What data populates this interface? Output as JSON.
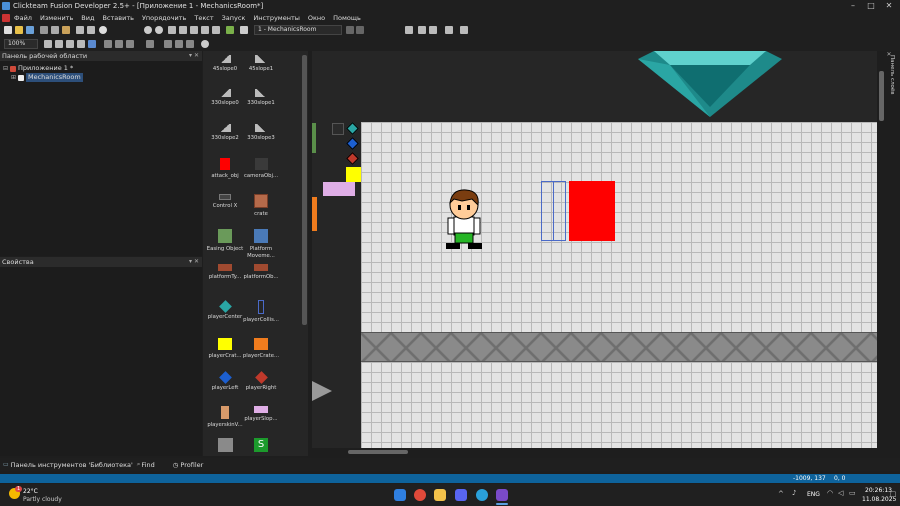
{
  "window": {
    "title": "Clickteam Fusion Developer 2.5+ - [Приложение 1 - MechanicsRoom*]",
    "controls": [
      "–",
      "□",
      "✕"
    ]
  },
  "menu": [
    "Файл",
    "Изменить",
    "Вид",
    "Вставить",
    "Упорядочить",
    "Текст",
    "Запуск",
    "Инструменты",
    "Окно",
    "Помощь"
  ],
  "toolbar": {
    "zoom": "100%",
    "frame_selector": "1 - MechanicsRoom"
  },
  "workspace_panel": {
    "title": "Панель рабочей области",
    "tree": [
      {
        "label": "Приложение 1 *",
        "level": 0
      },
      {
        "label": "MechanicsRoom",
        "level": 1,
        "selected": true
      }
    ]
  },
  "properties_panel": {
    "title": "Свойства"
  },
  "library": {
    "items": [
      {
        "label": "45slope0",
        "icon": "slope-left-icon"
      },
      {
        "label": "45slope1",
        "icon": "slope-right-icon"
      },
      {
        "label": "330slope0",
        "icon": "slope-left-icon"
      },
      {
        "label": "330slope1",
        "icon": "slope-right-icon"
      },
      {
        "label": "330slope2",
        "icon": "slope-left-icon"
      },
      {
        "label": "330slope3",
        "icon": "slope-right-icon"
      },
      {
        "label": "attack_obj",
        "icon": "red-square-icon"
      },
      {
        "label": "cameraObj...",
        "icon": "camera-icon"
      },
      {
        "label": "Control X",
        "icon": "control-icon"
      },
      {
        "label": "crate",
        "icon": "crate-icon"
      },
      {
        "label": "Easing Object",
        "icon": "easing-icon"
      },
      {
        "label": "Platform Moveme...",
        "icon": "platform-movement-icon"
      },
      {
        "label": "platformTy...",
        "icon": "platform-icon"
      },
      {
        "label": "platformOb...",
        "icon": "platform-icon"
      },
      {
        "label": "playerCenter",
        "icon": "diamond-teal-icon"
      },
      {
        "label": "playerCollis...",
        "icon": "collision-icon"
      },
      {
        "label": "playerCrat...",
        "icon": "yellow-square-icon"
      },
      {
        "label": "playerCrate...",
        "icon": "orange-square-icon"
      },
      {
        "label": "playerLeft",
        "icon": "diamond-blue-icon"
      },
      {
        "label": "playerRight",
        "icon": "diamond-red-icon"
      },
      {
        "label": "playerskinV...",
        "icon": "player-skin-icon"
      },
      {
        "label": "playerSlop...",
        "icon": "pink-rect-icon"
      },
      {
        "label": "",
        "icon": "gray-box-icon"
      },
      {
        "label": "",
        "icon": "green-s-icon"
      }
    ]
  },
  "right_panel": {
    "title": "Панель слоёв"
  },
  "bottom_tabs": [
    {
      "label": "Панель инструментов 'Библиотека'"
    },
    {
      "label": "Find"
    },
    {
      "label": "Profiler"
    }
  ],
  "status_bar": {
    "coords": "-1009, 137",
    "value": "0, 0"
  },
  "taskbar": {
    "weather_temp": "22°C",
    "weather_desc": "Partly cloudy",
    "weather_badge": "1",
    "lang": "ENG",
    "time": "20:26:13",
    "date": "11.08.2025"
  }
}
